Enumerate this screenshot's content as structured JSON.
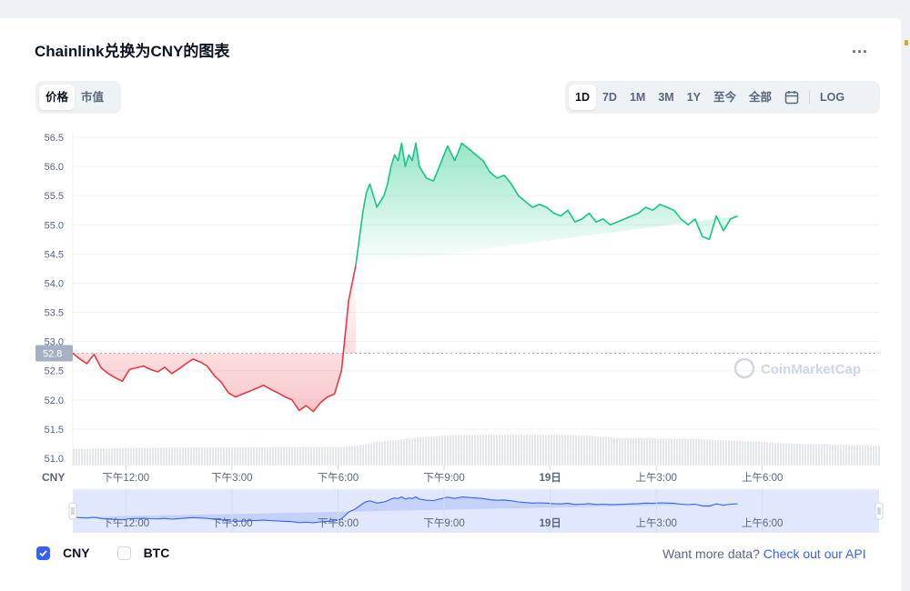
{
  "header": {
    "title": "Chainlink兑换为CNY的图表",
    "more_label": "..."
  },
  "mode_tabs": [
    {
      "label": "价格",
      "active": true
    },
    {
      "label": "市值",
      "active": false
    }
  ],
  "range_tabs": [
    {
      "label": "1D",
      "active": true
    },
    {
      "label": "7D",
      "active": false
    },
    {
      "label": "1M",
      "active": false
    },
    {
      "label": "3M",
      "active": false
    },
    {
      "label": "1Y",
      "active": false
    },
    {
      "label": "至今",
      "active": false
    },
    {
      "label": "全部",
      "active": false
    }
  ],
  "log_label": "LOG",
  "calendar_icon": "calendar-icon",
  "currency_label": "CNY",
  "watermark": "CoinMarketCap",
  "colors": {
    "up": "#16c784",
    "down": "#ea3943",
    "navigator": "#3861fb",
    "accent": "#3861fb"
  },
  "chart_data": {
    "type": "area",
    "y_ticks": [
      "56.5",
      "56.0",
      "55.5",
      "55.0",
      "54.5",
      "54.0",
      "53.5",
      "53.0",
      "52.5",
      "52.0",
      "51.5",
      "51.0"
    ],
    "ylim": [
      51.0,
      56.5
    ],
    "x_ticks": [
      "下午12:00",
      "下午3:00",
      "下午6:00",
      "下午9:00",
      "19日",
      "上午3:00",
      "上午6:00"
    ],
    "x_tick_hours": [
      3,
      6,
      9,
      12,
      15,
      18,
      21
    ],
    "xlim_hours": [
      1.5,
      24.3
    ],
    "reference_price": 52.8,
    "reference_label": "52.8",
    "grid": true,
    "price_series": {
      "name": "CNY",
      "x_hours": [
        1.5,
        1.7,
        1.9,
        2.1,
        2.3,
        2.5,
        2.7,
        2.9,
        3.1,
        3.3,
        3.5,
        3.7,
        3.9,
        4.1,
        4.3,
        4.5,
        4.7,
        4.9,
        5.1,
        5.3,
        5.5,
        5.7,
        5.9,
        6.1,
        6.3,
        6.5,
        6.7,
        6.9,
        7.1,
        7.3,
        7.5,
        7.7,
        7.9,
        8.1,
        8.3,
        8.5,
        8.7,
        8.9,
        9.1,
        9.3,
        9.5,
        9.7,
        9.8,
        9.9,
        10.0,
        10.1,
        10.2,
        10.3,
        10.4,
        10.5,
        10.6,
        10.7,
        10.8,
        10.9,
        11.0,
        11.1,
        11.2,
        11.3,
        11.5,
        11.7,
        11.9,
        12.1,
        12.3,
        12.5,
        12.7,
        12.9,
        13.1,
        13.3,
        13.5,
        13.7,
        13.9,
        14.1,
        14.3,
        14.5,
        14.7,
        14.9,
        15.1,
        15.3,
        15.5,
        15.7,
        15.9,
        16.1,
        16.3,
        16.5,
        16.7,
        16.9,
        17.1,
        17.3,
        17.5,
        17.7,
        17.9,
        18.1,
        18.3,
        18.5,
        18.7,
        18.9,
        19.1,
        19.3,
        19.5,
        19.7,
        19.9,
        20.1,
        20.3,
        20.5,
        20.7,
        20.9,
        21.1,
        21.3,
        21.5,
        21.7,
        21.9,
        22.1,
        22.3,
        22.5,
        22.7,
        22.9,
        23.1,
        23.3,
        23.5,
        23.7,
        23.9,
        24.1,
        24.3
      ],
      "values": [
        52.8,
        52.7,
        52.62,
        52.78,
        52.55,
        52.45,
        52.38,
        52.32,
        52.52,
        52.55,
        52.58,
        52.52,
        52.48,
        52.56,
        52.45,
        52.53,
        52.62,
        52.7,
        52.65,
        52.58,
        52.42,
        52.3,
        52.12,
        52.05,
        52.1,
        52.15,
        52.2,
        52.25,
        52.18,
        52.12,
        52.05,
        52.0,
        51.82,
        51.9,
        51.8,
        51.95,
        52.05,
        52.1,
        52.5,
        53.7,
        54.3,
        55.2,
        55.55,
        55.7,
        55.5,
        55.3,
        55.4,
        55.5,
        55.7,
        56.0,
        56.2,
        56.1,
        56.4,
        56.0,
        56.2,
        56.1,
        56.4,
        56.0,
        55.8,
        55.75,
        56.05,
        56.35,
        56.1,
        56.4,
        56.3,
        56.2,
        56.1,
        55.9,
        55.8,
        55.85,
        55.7,
        55.5,
        55.4,
        55.3,
        55.35,
        55.3,
        55.2,
        55.15,
        55.25,
        55.05,
        55.1,
        55.2,
        55.05,
        55.1,
        55.0,
        55.05,
        55.1,
        55.15,
        55.2,
        55.3,
        55.25,
        55.35,
        55.3,
        55.25,
        55.1,
        55.0,
        55.1,
        54.8,
        54.75,
        55.15,
        54.9,
        55.1,
        55.15
      ],
      "segment_split_hour": 9.5
    },
    "volume_series": {
      "name": "volume",
      "x_hours": [
        1.5,
        3,
        4.5,
        6,
        7.5,
        9,
        9.5,
        10,
        11,
        12,
        13,
        14,
        15,
        16,
        17,
        18,
        19,
        20,
        21,
        22,
        23,
        24.3
      ],
      "values": [
        0.3,
        0.32,
        0.33,
        0.33,
        0.34,
        0.34,
        0.36,
        0.42,
        0.5,
        0.55,
        0.56,
        0.56,
        0.56,
        0.55,
        0.5,
        0.5,
        0.49,
        0.46,
        0.43,
        0.4,
        0.38,
        0.37
      ]
    },
    "navigator": {
      "x_ticks": [
        "下午12:00",
        "下午3:00",
        "下午6:00",
        "下午9:00",
        "19日",
        "上午3:00",
        "上午6:00"
      ]
    }
  },
  "footer": {
    "checkboxes": [
      {
        "label": "CNY",
        "checked": true
      },
      {
        "label": "BTC",
        "checked": false
      }
    ],
    "api_prefix": "Want more data? ",
    "api_link": "Check out our API"
  }
}
